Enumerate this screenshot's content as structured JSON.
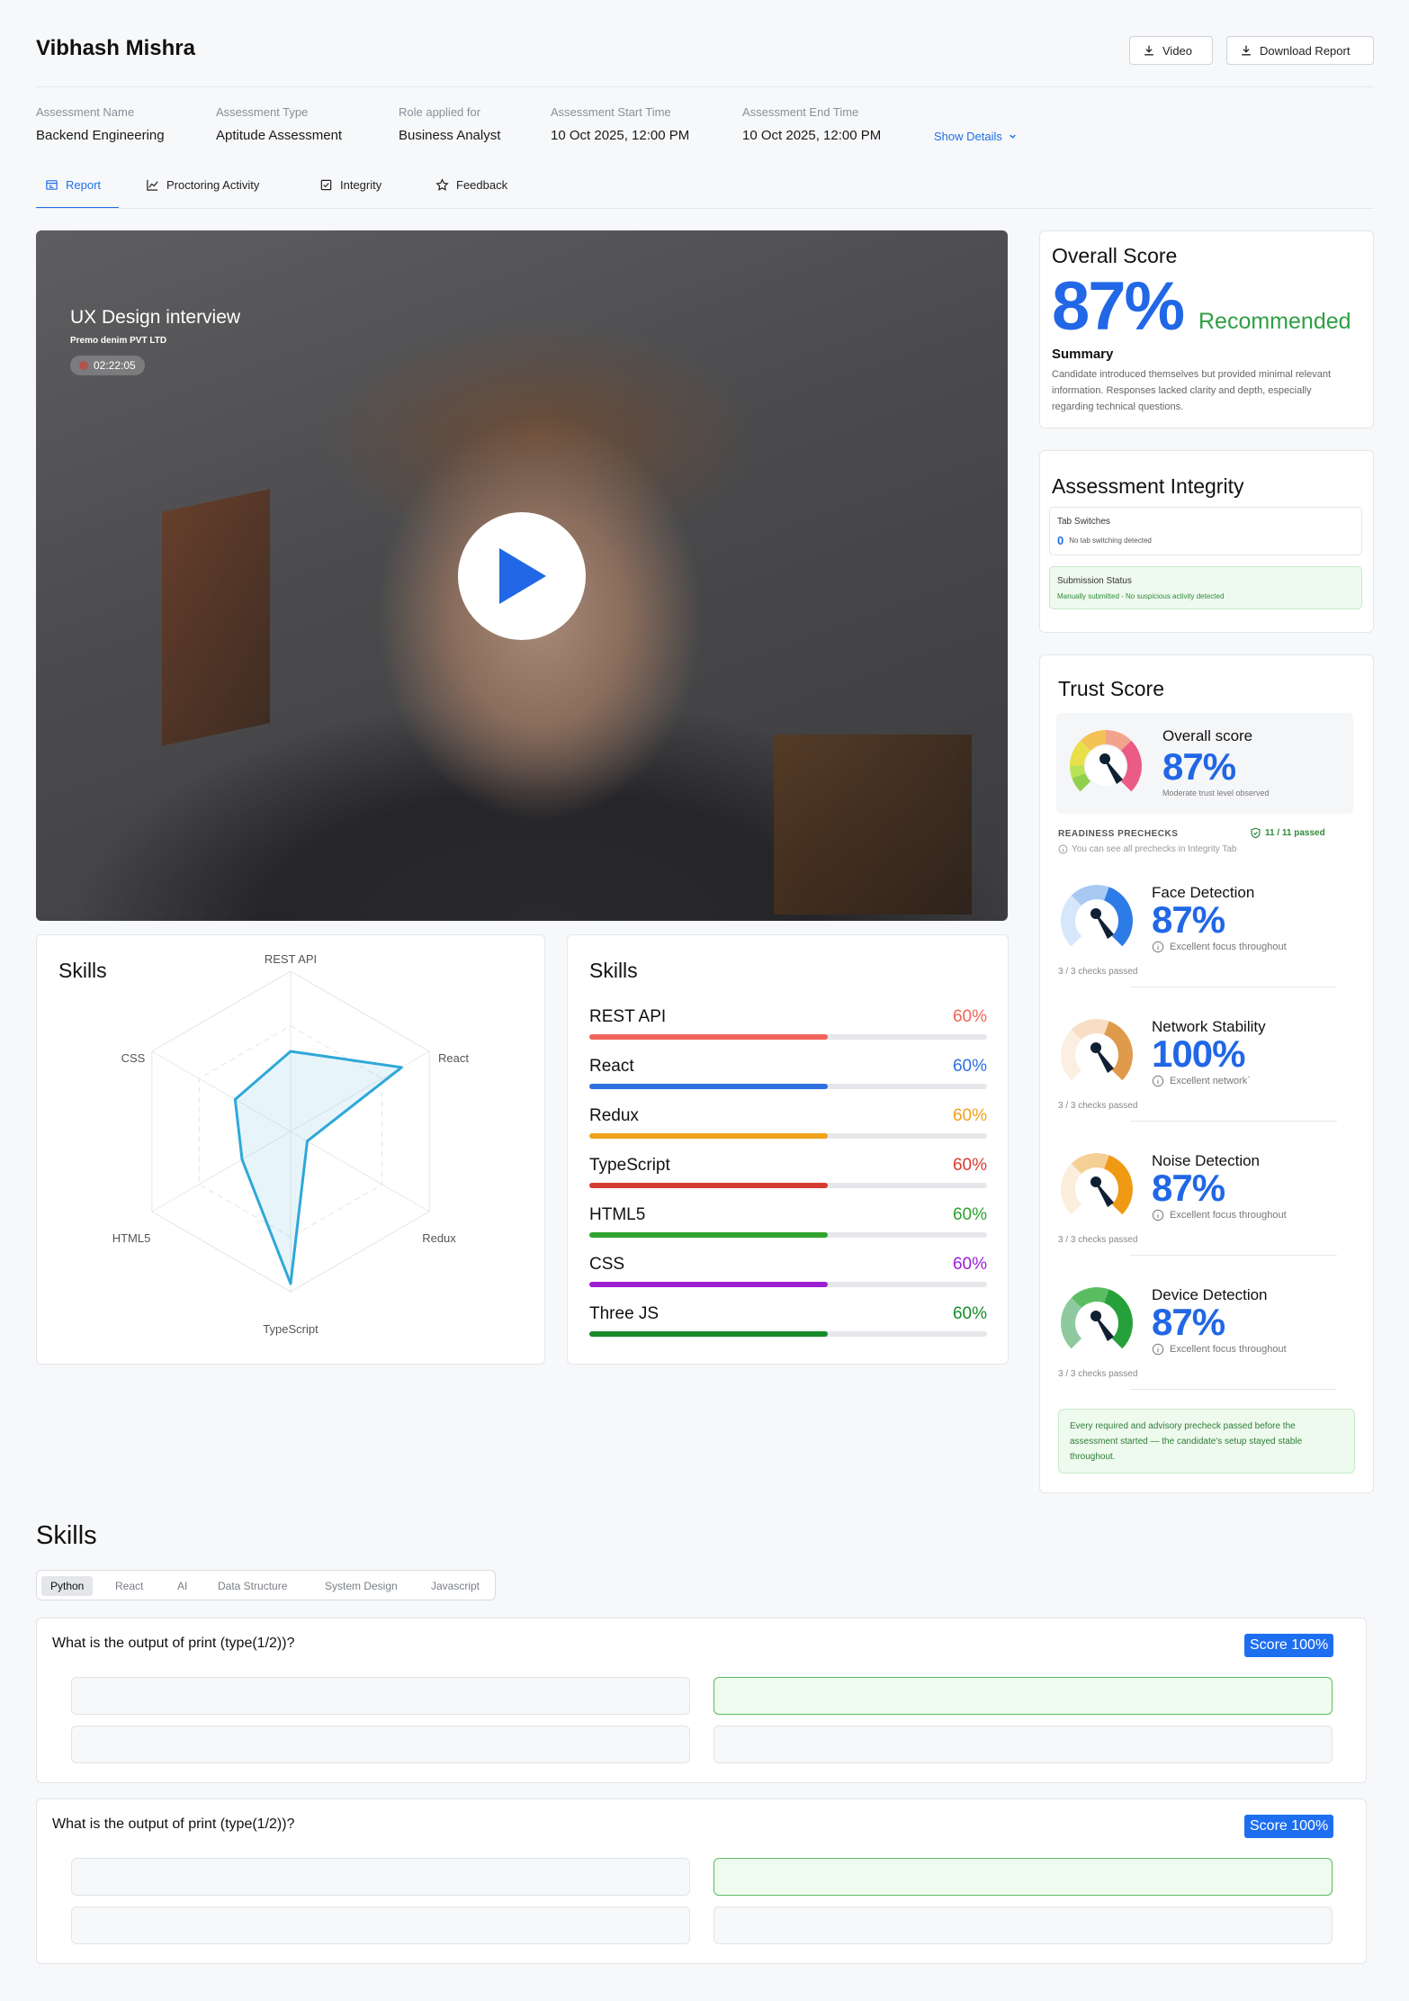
{
  "header": {
    "candidate_name": "Vibhash Mishra",
    "video_button": "Video",
    "download_button": "Download Report"
  },
  "meta": [
    {
      "label": "Assessment Name",
      "value": "Backend Engineering"
    },
    {
      "label": "Assessment Type",
      "value": "Aptitude Assessment"
    },
    {
      "label": "Role applied for",
      "value": "Business Analyst"
    },
    {
      "label": "Assessment Start Time",
      "value": "10 Oct 2025, 12:00 PM"
    },
    {
      "label": "Assessment End Time",
      "value": "10 Oct 2025, 12:00 PM"
    }
  ],
  "show_details": "Show Details",
  "tabs": [
    {
      "label": "Report",
      "icon": "report-icon",
      "active": true
    },
    {
      "label": "Proctoring Activity",
      "icon": "line-chart-icon",
      "active": false
    },
    {
      "label": "Integrity",
      "icon": "checkbox-icon",
      "active": false
    },
    {
      "label": "Feedback",
      "icon": "star-icon",
      "active": false
    }
  ],
  "video": {
    "title": "UX Design interview",
    "company": "Premo denim PVT LTD",
    "duration": "02:22:05"
  },
  "radar": {
    "title": "Skills",
    "chart_data": {
      "type": "radar",
      "axes": [
        "REST API",
        "React",
        "Redux",
        "TypeScript",
        "HTML5",
        "CSS"
      ],
      "values": [
        0.5,
        0.8,
        0.12,
        0.95,
        0.35,
        0.4
      ],
      "range": [
        0,
        1
      ],
      "grid": true
    }
  },
  "skills_bars": {
    "title": "Skills",
    "items": [
      {
        "name": "REST API",
        "pct_label": "60%",
        "value": 60,
        "color": "#f0655a"
      },
      {
        "name": "React",
        "pct_label": "60%",
        "value": 60,
        "color": "#2f6fe0"
      },
      {
        "name": "Redux",
        "pct_label": "60%",
        "value": 60,
        "color": "#f0a21b"
      },
      {
        "name": "TypeScript",
        "pct_label": "60%",
        "value": 60,
        "color": "#d63b32"
      },
      {
        "name": "HTML5",
        "pct_label": "60%",
        "value": 60,
        "color": "#2ea32e"
      },
      {
        "name": "CSS",
        "pct_label": "60%",
        "value": 60,
        "color": "#9c1fd0"
      },
      {
        "name": "Three JS",
        "pct_label": "60%",
        "value": 60,
        "color": "#178a2a"
      }
    ]
  },
  "overall": {
    "title": "Overall Score",
    "score": "87%",
    "verdict": "Recommended",
    "summary_label": "Summary",
    "summary": "Candidate introduced themselves but provided minimal relevant information. Responses lacked clarity and depth, especially regarding technical questions."
  },
  "integrity": {
    "title": "Assessment Integrity",
    "tab_switches_label": "Tab Switches",
    "tab_switches_count": "0",
    "tab_switches_text": "No tab switching detected",
    "submission_label": "Submission Status",
    "submission_text": "Manually submitted - No suspicious activity detected"
  },
  "trust": {
    "title": "Trust Score",
    "overall_label": "Overall score",
    "overall_value": "87%",
    "overall_sub": "Moderate trust level observed",
    "prechecks_label": "READINESS PRECHECKS",
    "prechecks_passed": "11 / 11 passed",
    "prechecks_hint": "You can see all prechecks in Integrity Tab",
    "items": [
      {
        "label": "Face Detection",
        "value": "87%",
        "sub": "Excellent focus throughout",
        "checks": "3 / 3 checks passed",
        "colors": [
          "#d6e6fb",
          "#a8c9f4",
          "#2d7be6"
        ]
      },
      {
        "label": "Network Stability",
        "value": "100%",
        "sub": "Excellent network`",
        "checks": "3 / 3 checks passed",
        "colors": [
          "#fbefe2",
          "#f7dec4",
          "#e09a4c"
        ]
      },
      {
        "label": "Noise Detection",
        "value": "87%",
        "sub": "Excellent focus throughout",
        "checks": "3 / 3 checks passed",
        "colors": [
          "#fbeedd",
          "#f5cf96",
          "#ef9a12"
        ]
      },
      {
        "label": "Device Detection",
        "value": "87%",
        "sub": "Excellent focus throughout",
        "checks": "3 / 3 checks passed",
        "colors": [
          "#8fc9a0",
          "#5bbd62",
          "#25a03a"
        ]
      }
    ],
    "footer": "Every required and advisory precheck passed before the assessment started — the candidate's setup stayed stable throughout."
  },
  "question_section": {
    "title": "Skills",
    "tabs": [
      "Python",
      "React",
      "AI",
      "Data Structure",
      "System Design",
      "Javascript"
    ],
    "questions": [
      {
        "text": "What is the output of print (type(1/2))?",
        "score": "Score 100%"
      },
      {
        "text": "What is the output of print (type(1/2))?",
        "score": "Score 100%"
      }
    ]
  }
}
